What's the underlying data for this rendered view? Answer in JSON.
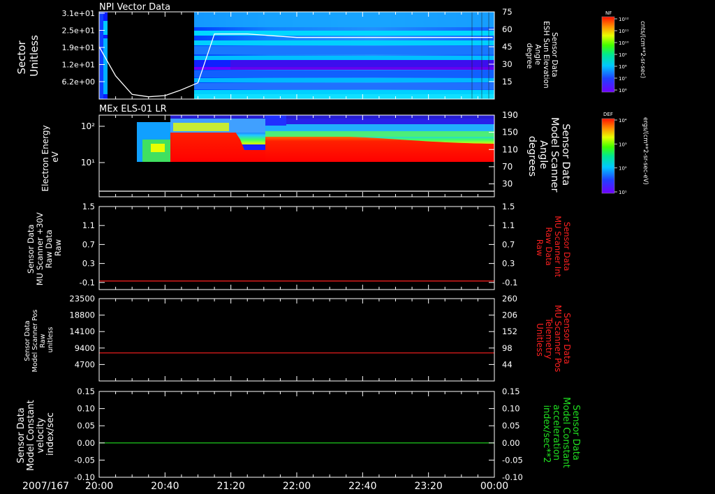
{
  "chart_data": [
    {
      "type": "heatmap",
      "title": "NPI Vector Data",
      "ylabel_left": [
        "Sector",
        "Unitless"
      ],
      "yticks_left": [
        "3.1e+01",
        "2.5e+01",
        "1.9e+01",
        "1.2e+01",
        "6.2e+00"
      ],
      "ylabel_right": [
        "Sensor Data",
        "ESH Sun Elevation",
        "Angle",
        "degree"
      ],
      "yticks_right": [
        "75",
        "60",
        "45",
        "30",
        "15"
      ],
      "ylim_right": [
        0,
        75
      ],
      "overlay": {
        "name": "ESH Sun Elevation Angle",
        "x": [
          "20:00",
          "20:10",
          "20:20",
          "20:30",
          "20:40",
          "20:50",
          "21:00",
          "21:10",
          "21:30",
          "22:00",
          "22:40",
          "23:20",
          "23:59"
        ],
        "y": [
          45,
          20,
          4,
          2,
          3,
          8,
          14,
          56,
          56,
          53,
          53,
          53,
          53
        ]
      },
      "colorbar": {
        "label": "NF",
        "units": "cnts/(cm**2-sr-sec)",
        "ticks": [
          "10¹²",
          "10¹¹",
          "10¹⁰",
          "10⁹",
          "10⁸",
          "10⁷",
          "10⁶"
        ]
      }
    },
    {
      "type": "heatmap",
      "title": "MEx ELS-01 LR",
      "ylabel_left": [
        "Electron Energy",
        "eV"
      ],
      "yticks_left": [
        "10²",
        "10¹"
      ],
      "ylabel_right": [
        "Sensor Data",
        "Model Scanner",
        "Angle",
        "degrees"
      ],
      "yticks_right": [
        "190",
        "150",
        "110",
        "70",
        "30"
      ],
      "ylim_right": [
        0,
        190
      ],
      "overlay": {
        "name": "Model Scanner Angle",
        "value": 0
      },
      "colorbar": {
        "label": "DEF",
        "units": "ergs/(cm**2-sr-sec-eV)",
        "ticks": [
          "10⁴",
          "10³",
          "10²",
          "10¹"
        ]
      }
    },
    {
      "type": "line",
      "ylabel_left": [
        "Sensor Data",
        "MU Scanner +30V",
        "Raw Data",
        "Raw"
      ],
      "yticks_left": [
        "1.5",
        "1.1",
        "0.7",
        "0.3",
        "-0.1"
      ],
      "ylabel_right": [
        "Sensor Data",
        "MU Scanner Int",
        "Raw Data",
        "Raw"
      ],
      "yticks_right": [
        "1.5",
        "1.1",
        "0.7",
        "0.3",
        "-0.1"
      ],
      "ylim": [
        -0.25,
        1.5
      ],
      "series": [
        {
          "name": "MU Scanner Int Raw Data",
          "color": "#ff2020",
          "value": -0.07
        }
      ]
    },
    {
      "type": "line",
      "ylabel_left": [
        "Sensor Data",
        "Model Scanner Pos",
        "Raw",
        "unitless"
      ],
      "yticks_left": [
        "23500",
        "18800",
        "14100",
        "9400",
        "4700"
      ],
      "ylabel_right": [
        "Sensor Data",
        "MU Scanner Pos",
        "Telemetry",
        "Unitless"
      ],
      "yticks_right": [
        "260",
        "206",
        "152",
        "98",
        "44"
      ],
      "ylim": [
        0,
        23500
      ],
      "series": [
        {
          "name": "MU Scanner Pos Telemetry",
          "color": "#ff2020",
          "value": 8000
        }
      ]
    },
    {
      "type": "line",
      "ylabel_left": [
        "Sensor Data",
        "Model Constant",
        "velocity",
        "index/sec"
      ],
      "yticks_left": [
        "0.15",
        "0.10",
        "0.05",
        "0.00",
        "-0.05",
        "-0.10"
      ],
      "ylabel_right": [
        "Sensor Data",
        "Model Constant",
        "acceleration",
        "index/sec**2"
      ],
      "yticks_right": [
        "0.15",
        "0.10",
        "0.05",
        "0.00",
        "-0.05",
        "-0.10"
      ],
      "ylim": [
        -0.1,
        0.15
      ],
      "series": [
        {
          "name": "Model Constant acceleration",
          "color": "#20e020",
          "value": 0.0
        }
      ]
    }
  ],
  "xaxis": {
    "date": "2007/167",
    "ticks": [
      "20:00",
      "20:40",
      "21:20",
      "22:00",
      "22:40",
      "23:20",
      "00:00"
    ]
  },
  "colors": {
    "background": "#000000",
    "axes": "#ffffff",
    "red_label": "#ff2020",
    "green_label": "#20e020"
  }
}
